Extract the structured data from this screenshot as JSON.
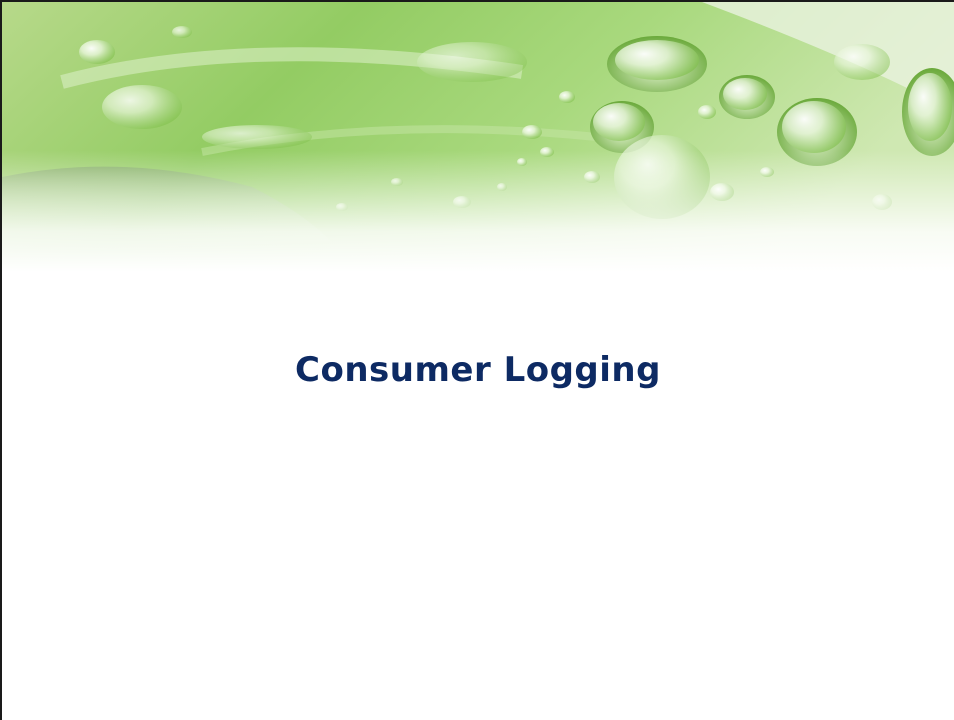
{
  "slide": {
    "title": "Consumer Logging",
    "title_color": "#0d2a63",
    "background": "#ffffff",
    "banner_image": "green-leaf-water-droplets"
  }
}
